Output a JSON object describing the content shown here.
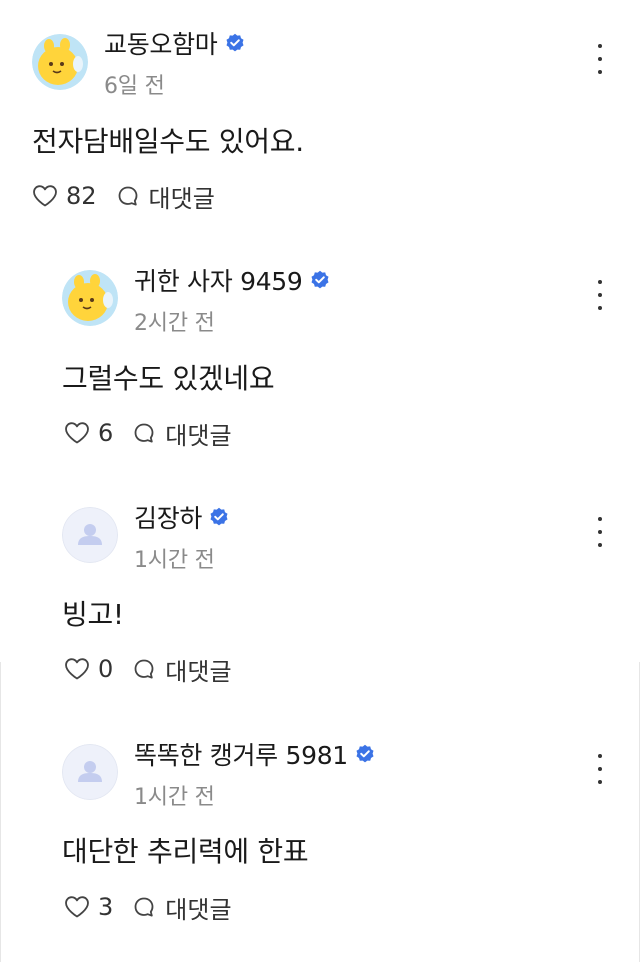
{
  "comments": [
    {
      "author": "교동오함마",
      "verified": true,
      "time": "6일 전",
      "text": "전자담배일수도 있어요.",
      "likes": "82",
      "reply_label": "대댓글",
      "avatar_type": "character"
    },
    {
      "author": "귀한 사자 9459",
      "verified": true,
      "time": "2시간 전",
      "text": "그럴수도 있겠네요",
      "likes": "6",
      "reply_label": "대댓글",
      "avatar_type": "character"
    },
    {
      "author": "김장하",
      "verified": true,
      "time": "1시간 전",
      "text": "빙고!",
      "likes": "0",
      "reply_label": "대댓글",
      "avatar_type": "default"
    },
    {
      "author": "똑똑한 캥거루 5981",
      "verified": true,
      "time": "1시간 전",
      "text": "대단한 추리력에 한표",
      "likes": "3",
      "reply_label": "대댓글",
      "avatar_type": "default"
    }
  ],
  "colors": {
    "verified_badge": "#3b73e6",
    "time_text": "#8a8a8a",
    "default_avatar_bg": "#eef1fa",
    "default_avatar_fg": "#c4cdef",
    "character_bg": "#bfe4f6",
    "character_face": "#ffd43b"
  }
}
